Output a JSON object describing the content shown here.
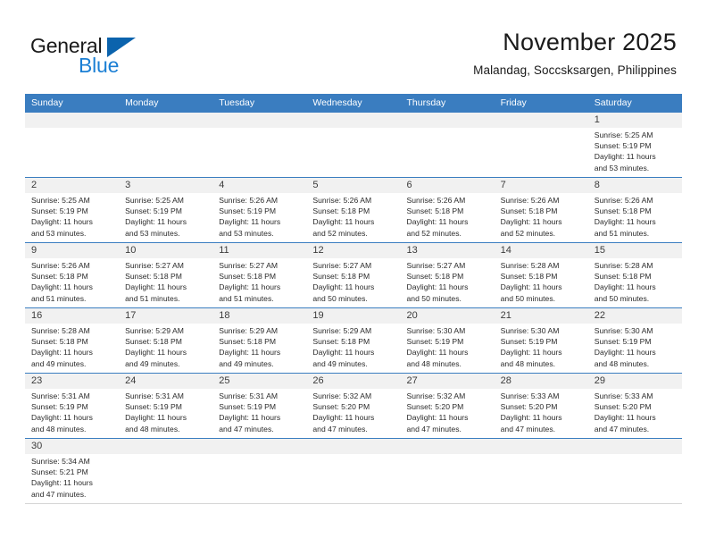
{
  "brand": {
    "name_top": "General",
    "name_bottom": "Blue",
    "triangle_color": "#0b63ad",
    "text_color_top": "#1a1a1a",
    "text_color_bottom": "#1b7fd4"
  },
  "header": {
    "title": "November 2025",
    "subtitle": "Malandag, Soccsksargen, Philippines"
  },
  "theme": {
    "header_row_bg": "#3a7dc0",
    "header_row_text": "#ffffff",
    "day_number_bg": "#f1f1f1",
    "week_divider": "#3a7dc0",
    "body_text": "#2a2a2a"
  },
  "weekdays": [
    "Sunday",
    "Monday",
    "Tuesday",
    "Wednesday",
    "Thursday",
    "Friday",
    "Saturday"
  ],
  "weeks": [
    {
      "days": [
        {
          "number": "",
          "empty": true
        },
        {
          "number": "",
          "empty": true
        },
        {
          "number": "",
          "empty": true
        },
        {
          "number": "",
          "empty": true
        },
        {
          "number": "",
          "empty": true
        },
        {
          "number": "",
          "empty": true
        },
        {
          "number": "1",
          "sunrise": "Sunrise: 5:25 AM",
          "sunset": "Sunset: 5:19 PM",
          "daylight1": "Daylight: 11 hours",
          "daylight2": "and 53 minutes."
        }
      ]
    },
    {
      "days": [
        {
          "number": "2",
          "sunrise": "Sunrise: 5:25 AM",
          "sunset": "Sunset: 5:19 PM",
          "daylight1": "Daylight: 11 hours",
          "daylight2": "and 53 minutes."
        },
        {
          "number": "3",
          "sunrise": "Sunrise: 5:25 AM",
          "sunset": "Sunset: 5:19 PM",
          "daylight1": "Daylight: 11 hours",
          "daylight2": "and 53 minutes."
        },
        {
          "number": "4",
          "sunrise": "Sunrise: 5:26 AM",
          "sunset": "Sunset: 5:19 PM",
          "daylight1": "Daylight: 11 hours",
          "daylight2": "and 53 minutes."
        },
        {
          "number": "5",
          "sunrise": "Sunrise: 5:26 AM",
          "sunset": "Sunset: 5:18 PM",
          "daylight1": "Daylight: 11 hours",
          "daylight2": "and 52 minutes."
        },
        {
          "number": "6",
          "sunrise": "Sunrise: 5:26 AM",
          "sunset": "Sunset: 5:18 PM",
          "daylight1": "Daylight: 11 hours",
          "daylight2": "and 52 minutes."
        },
        {
          "number": "7",
          "sunrise": "Sunrise: 5:26 AM",
          "sunset": "Sunset: 5:18 PM",
          "daylight1": "Daylight: 11 hours",
          "daylight2": "and 52 minutes."
        },
        {
          "number": "8",
          "sunrise": "Sunrise: 5:26 AM",
          "sunset": "Sunset: 5:18 PM",
          "daylight1": "Daylight: 11 hours",
          "daylight2": "and 51 minutes."
        }
      ]
    },
    {
      "days": [
        {
          "number": "9",
          "sunrise": "Sunrise: 5:26 AM",
          "sunset": "Sunset: 5:18 PM",
          "daylight1": "Daylight: 11 hours",
          "daylight2": "and 51 minutes."
        },
        {
          "number": "10",
          "sunrise": "Sunrise: 5:27 AM",
          "sunset": "Sunset: 5:18 PM",
          "daylight1": "Daylight: 11 hours",
          "daylight2": "and 51 minutes."
        },
        {
          "number": "11",
          "sunrise": "Sunrise: 5:27 AM",
          "sunset": "Sunset: 5:18 PM",
          "daylight1": "Daylight: 11 hours",
          "daylight2": "and 51 minutes."
        },
        {
          "number": "12",
          "sunrise": "Sunrise: 5:27 AM",
          "sunset": "Sunset: 5:18 PM",
          "daylight1": "Daylight: 11 hours",
          "daylight2": "and 50 minutes."
        },
        {
          "number": "13",
          "sunrise": "Sunrise: 5:27 AM",
          "sunset": "Sunset: 5:18 PM",
          "daylight1": "Daylight: 11 hours",
          "daylight2": "and 50 minutes."
        },
        {
          "number": "14",
          "sunrise": "Sunrise: 5:28 AM",
          "sunset": "Sunset: 5:18 PM",
          "daylight1": "Daylight: 11 hours",
          "daylight2": "and 50 minutes."
        },
        {
          "number": "15",
          "sunrise": "Sunrise: 5:28 AM",
          "sunset": "Sunset: 5:18 PM",
          "daylight1": "Daylight: 11 hours",
          "daylight2": "and 50 minutes."
        }
      ]
    },
    {
      "days": [
        {
          "number": "16",
          "sunrise": "Sunrise: 5:28 AM",
          "sunset": "Sunset: 5:18 PM",
          "daylight1": "Daylight: 11 hours",
          "daylight2": "and 49 minutes."
        },
        {
          "number": "17",
          "sunrise": "Sunrise: 5:29 AM",
          "sunset": "Sunset: 5:18 PM",
          "daylight1": "Daylight: 11 hours",
          "daylight2": "and 49 minutes."
        },
        {
          "number": "18",
          "sunrise": "Sunrise: 5:29 AM",
          "sunset": "Sunset: 5:18 PM",
          "daylight1": "Daylight: 11 hours",
          "daylight2": "and 49 minutes."
        },
        {
          "number": "19",
          "sunrise": "Sunrise: 5:29 AM",
          "sunset": "Sunset: 5:18 PM",
          "daylight1": "Daylight: 11 hours",
          "daylight2": "and 49 minutes."
        },
        {
          "number": "20",
          "sunrise": "Sunrise: 5:30 AM",
          "sunset": "Sunset: 5:19 PM",
          "daylight1": "Daylight: 11 hours",
          "daylight2": "and 48 minutes."
        },
        {
          "number": "21",
          "sunrise": "Sunrise: 5:30 AM",
          "sunset": "Sunset: 5:19 PM",
          "daylight1": "Daylight: 11 hours",
          "daylight2": "and 48 minutes."
        },
        {
          "number": "22",
          "sunrise": "Sunrise: 5:30 AM",
          "sunset": "Sunset: 5:19 PM",
          "daylight1": "Daylight: 11 hours",
          "daylight2": "and 48 minutes."
        }
      ]
    },
    {
      "days": [
        {
          "number": "23",
          "sunrise": "Sunrise: 5:31 AM",
          "sunset": "Sunset: 5:19 PM",
          "daylight1": "Daylight: 11 hours",
          "daylight2": "and 48 minutes."
        },
        {
          "number": "24",
          "sunrise": "Sunrise: 5:31 AM",
          "sunset": "Sunset: 5:19 PM",
          "daylight1": "Daylight: 11 hours",
          "daylight2": "and 48 minutes."
        },
        {
          "number": "25",
          "sunrise": "Sunrise: 5:31 AM",
          "sunset": "Sunset: 5:19 PM",
          "daylight1": "Daylight: 11 hours",
          "daylight2": "and 47 minutes."
        },
        {
          "number": "26",
          "sunrise": "Sunrise: 5:32 AM",
          "sunset": "Sunset: 5:20 PM",
          "daylight1": "Daylight: 11 hours",
          "daylight2": "and 47 minutes."
        },
        {
          "number": "27",
          "sunrise": "Sunrise: 5:32 AM",
          "sunset": "Sunset: 5:20 PM",
          "daylight1": "Daylight: 11 hours",
          "daylight2": "and 47 minutes."
        },
        {
          "number": "28",
          "sunrise": "Sunrise: 5:33 AM",
          "sunset": "Sunset: 5:20 PM",
          "daylight1": "Daylight: 11 hours",
          "daylight2": "and 47 minutes."
        },
        {
          "number": "29",
          "sunrise": "Sunrise: 5:33 AM",
          "sunset": "Sunset: 5:20 PM",
          "daylight1": "Daylight: 11 hours",
          "daylight2": "and 47 minutes."
        }
      ]
    },
    {
      "days": [
        {
          "number": "30",
          "sunrise": "Sunrise: 5:34 AM",
          "sunset": "Sunset: 5:21 PM",
          "daylight1": "Daylight: 11 hours",
          "daylight2": "and 47 minutes."
        },
        {
          "number": "",
          "empty": true
        },
        {
          "number": "",
          "empty": true
        },
        {
          "number": "",
          "empty": true
        },
        {
          "number": "",
          "empty": true
        },
        {
          "number": "",
          "empty": true
        },
        {
          "number": "",
          "empty": true
        }
      ]
    }
  ]
}
